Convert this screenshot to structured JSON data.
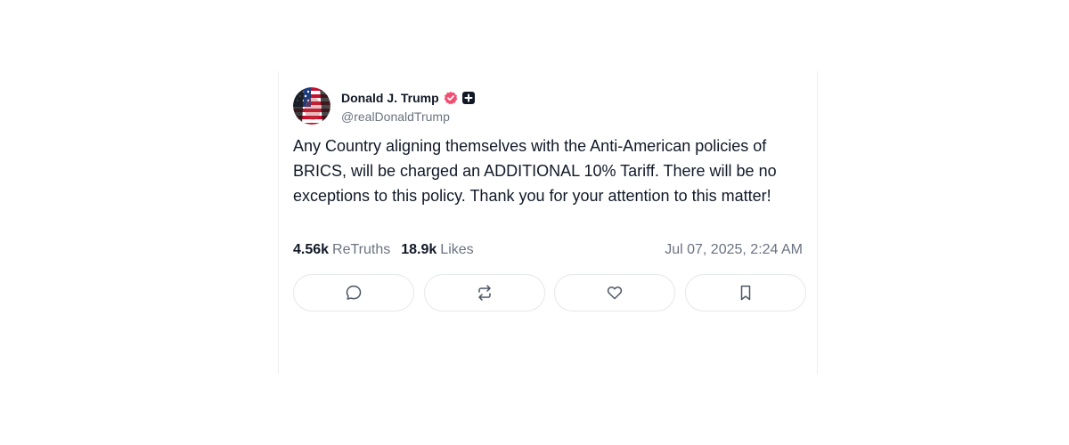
{
  "post": {
    "author": {
      "display_name": "Donald J. Trump",
      "handle": "@realDonaldTrump",
      "verified": true,
      "verified_color": "#f04f74"
    },
    "text": "Any Country aligning themselves with the Anti-American policies of BRICS, will be charged an ADDITIONAL 10% Tariff. There will be no exceptions to this policy. Thank you for your attention to this matter!",
    "stats": {
      "retruths_count": "4.56k",
      "retruths_label": "ReTruths",
      "likes_count": "18.9k",
      "likes_label": "Likes"
    },
    "timestamp": "Jul 07, 2025, 2:24 AM",
    "actions": [
      {
        "name": "reply",
        "icon": "comment-icon"
      },
      {
        "name": "retruth",
        "icon": "repost-icon"
      },
      {
        "name": "like",
        "icon": "heart-icon"
      },
      {
        "name": "bookmark",
        "icon": "bookmark-icon"
      }
    ]
  }
}
